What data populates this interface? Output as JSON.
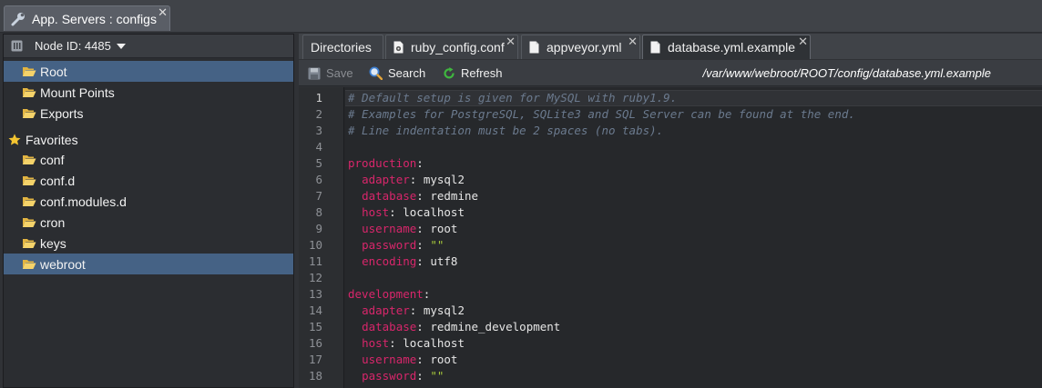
{
  "window_tab": {
    "title": "App. Servers : configs",
    "close": "✕"
  },
  "left": {
    "node_label": "Node ID: 4485",
    "items": [
      {
        "label": "Root",
        "selected": true
      },
      {
        "label": "Mount Points",
        "selected": false
      },
      {
        "label": "Exports",
        "selected": false
      },
      {
        "label": "Favorites",
        "selected": false
      },
      {
        "label": "conf",
        "selected": false
      },
      {
        "label": "conf.d",
        "selected": false
      },
      {
        "label": "conf.modules.d",
        "selected": false
      },
      {
        "label": "cron",
        "selected": false
      },
      {
        "label": "keys",
        "selected": false
      },
      {
        "label": "webroot",
        "selected": true
      }
    ]
  },
  "tabs": [
    {
      "label": "Directories"
    },
    {
      "label": "ruby_config.conf",
      "close": "✕"
    },
    {
      "label": "appveyor.yml",
      "close": "✕"
    },
    {
      "label": "database.yml.example",
      "close": "✕",
      "active": true
    }
  ],
  "toolbar": {
    "save": "Save",
    "search": "Search",
    "refresh": "Refresh",
    "path": "/var/www/webroot/ROOT/config/database.yml.example"
  },
  "editor": {
    "current_line": "1",
    "line_numbers": [
      "1",
      "2",
      "3",
      "4",
      "5",
      "6",
      "7",
      "8",
      "9",
      "10",
      "11",
      "12",
      "13",
      "14",
      "15",
      "16",
      "17",
      "18"
    ],
    "lines": [
      "# Default setup is given for MySQL with ruby1.9.",
      "# Examples for PostgreSQL, SQLite3 and SQL Server can be found at the end.",
      "# Line indentation must be 2 spaces (no tabs).",
      "",
      "production:",
      "  adapter: mysql2",
      "  database: redmine",
      "  host: localhost",
      "  username: root",
      "  password: \"\"",
      "  encoding: utf8",
      "",
      "development:",
      "  adapter: mysql2",
      "  database: redmine_development",
      "  host: localhost",
      "  username: root",
      "  password: \"\""
    ]
  },
  "colors": {
    "selection": "#456285",
    "yaml_key": "#d8266b",
    "yaml_string": "#a6c93a",
    "comment": "#6b7a8e"
  }
}
